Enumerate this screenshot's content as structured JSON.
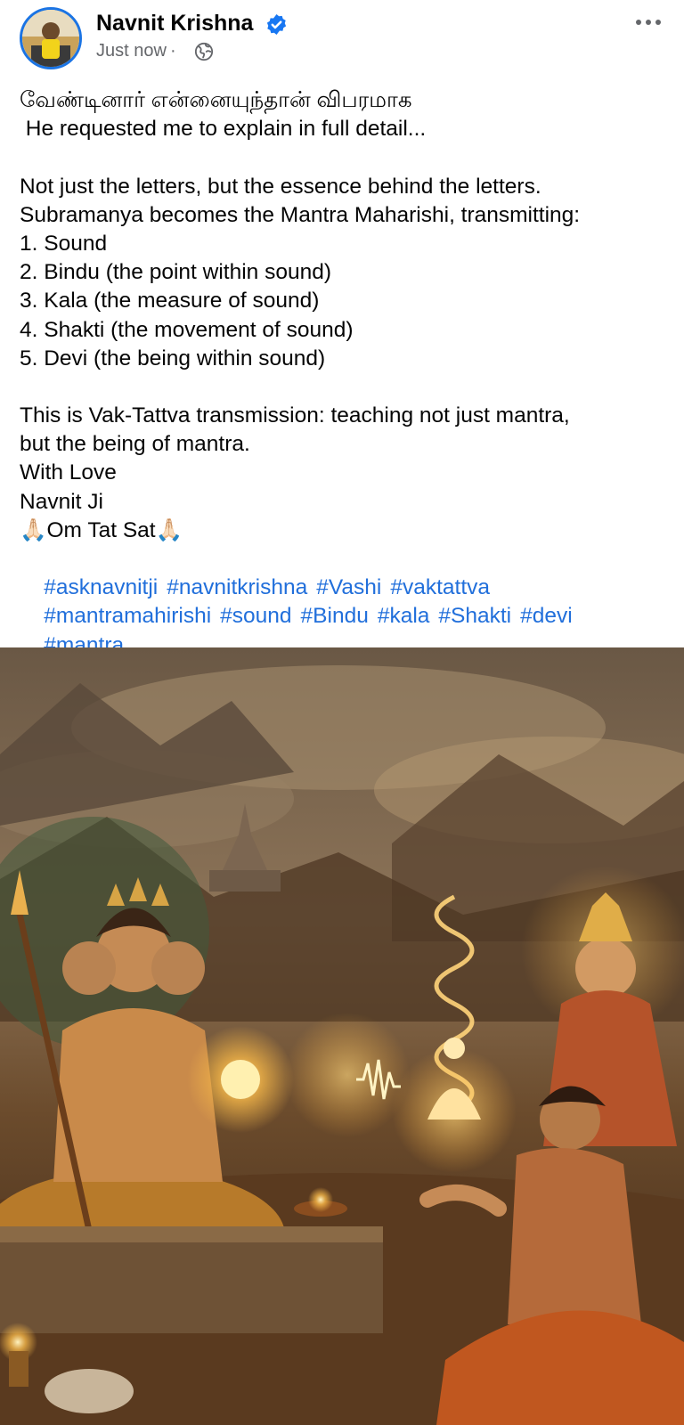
{
  "post": {
    "author": "Navnit Krishna",
    "verified": true,
    "timestamp": "Just now",
    "privacy_icon": "globe-icon",
    "lines": [
      "வேண்டினார் என்னையுந்தான் விபரமாக",
      " He requested me to explain in full detail...",
      "",
      "Not just the letters, but the essence behind the letters.",
      "Subramanya becomes the Mantra Maharishi, transmitting:",
      "1. Sound",
      "2. Bindu (the point within sound)",
      "3. Kala (the measure of sound)",
      "4. Shakti (the movement of sound)",
      "5. Devi (the being within sound)",
      "",
      "This is Vak-Tattva transmission: teaching not just mantra,",
      "but the being of mantra.",
      "With Love",
      "Navnit Ji",
      "🙏🏻Om Tat Sat🙏🏻"
    ],
    "hashtags": [
      [
        "#asknavnitji",
        "#navnitkrishna",
        "#Vashi",
        "#vaktattva"
      ],
      [
        "#mantramahirishi",
        "#sound",
        "#Bindu",
        "#kala",
        "#Shakti",
        "#devi"
      ],
      [
        "#mantra"
      ]
    ]
  },
  "colors": {
    "verified_badge": "#1877f2",
    "hashtag": "#216fdb",
    "meta_text": "#65676b"
  }
}
